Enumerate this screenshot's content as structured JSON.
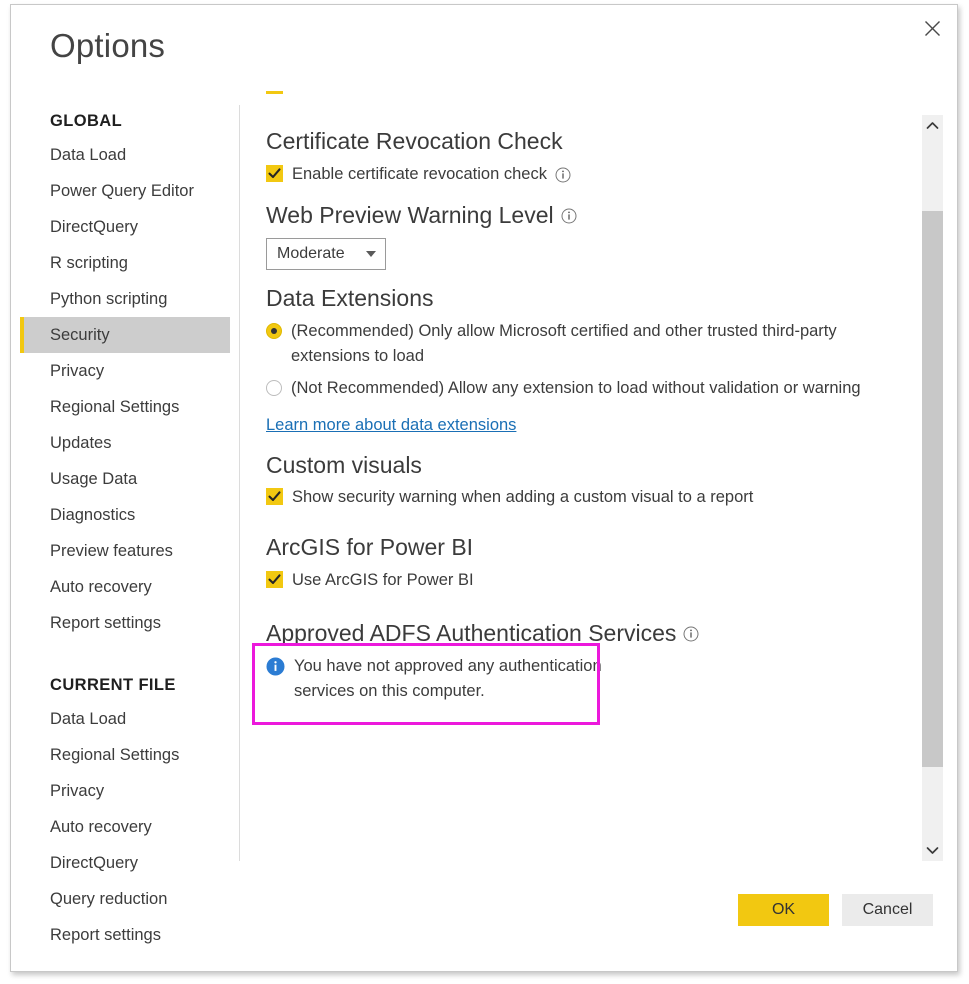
{
  "dialog": {
    "title": "Options",
    "close_label": "Close"
  },
  "sidebar": {
    "groups": [
      {
        "title": "GLOBAL",
        "items": [
          {
            "label": "Data Load",
            "selected": false
          },
          {
            "label": "Power Query Editor",
            "selected": false
          },
          {
            "label": "DirectQuery",
            "selected": false
          },
          {
            "label": "R scripting",
            "selected": false
          },
          {
            "label": "Python scripting",
            "selected": false
          },
          {
            "label": "Security",
            "selected": true
          },
          {
            "label": "Privacy",
            "selected": false
          },
          {
            "label": "Regional Settings",
            "selected": false
          },
          {
            "label": "Updates",
            "selected": false
          },
          {
            "label": "Usage Data",
            "selected": false
          },
          {
            "label": "Diagnostics",
            "selected": false
          },
          {
            "label": "Preview features",
            "selected": false
          },
          {
            "label": "Auto recovery",
            "selected": false
          },
          {
            "label": "Report settings",
            "selected": false
          }
        ]
      },
      {
        "title": "CURRENT FILE",
        "items": [
          {
            "label": "Data Load",
            "selected": false
          },
          {
            "label": "Regional Settings",
            "selected": false
          },
          {
            "label": "Privacy",
            "selected": false
          },
          {
            "label": "Auto recovery",
            "selected": false
          },
          {
            "label": "DirectQuery",
            "selected": false
          },
          {
            "label": "Query reduction",
            "selected": false
          },
          {
            "label": "Report settings",
            "selected": false
          }
        ]
      }
    ]
  },
  "content": {
    "certificate_revocation": {
      "heading": "Certificate Revocation Check",
      "checkbox_label": "Enable certificate revocation check",
      "checked": true,
      "info_icon": "info-icon"
    },
    "web_preview": {
      "heading": "Web Preview Warning Level",
      "info_icon": "info-icon",
      "dropdown_value": "Moderate",
      "dropdown_options": [
        "Moderate"
      ]
    },
    "data_extensions": {
      "heading": "Data Extensions",
      "options": [
        {
          "label": "(Recommended) Only allow Microsoft certified and other trusted third-party extensions to load",
          "selected": true
        },
        {
          "label": "(Not Recommended) Allow any extension to load without validation or warning",
          "selected": false
        }
      ],
      "link_text": "Learn more about data extensions"
    },
    "custom_visuals": {
      "heading": "Custom visuals",
      "checkbox_label": "Show security warning when adding a custom visual to a report",
      "checked": true
    },
    "arcgis": {
      "heading": "ArcGIS for Power BI",
      "checkbox_label": "Use ArcGIS for Power BI",
      "checked": true,
      "highlighted": true
    },
    "adfs": {
      "heading": "Approved ADFS Authentication Services",
      "info_icon": "info-icon",
      "message": "You have not approved any authentication services on this computer.",
      "message_icon": "info-circle-blue-icon"
    }
  },
  "scrollbar": {
    "up_icon": "chevron-up-icon",
    "down_icon": "chevron-down-icon"
  },
  "footer": {
    "ok_label": "OK",
    "cancel_label": "Cancel"
  },
  "colors": {
    "accent": "#f2c811",
    "highlight": "#ec18dc",
    "link": "#1a6fb5",
    "info_blue": "#2b7cd3",
    "selected_nav_bg": "#cdcdcd"
  }
}
